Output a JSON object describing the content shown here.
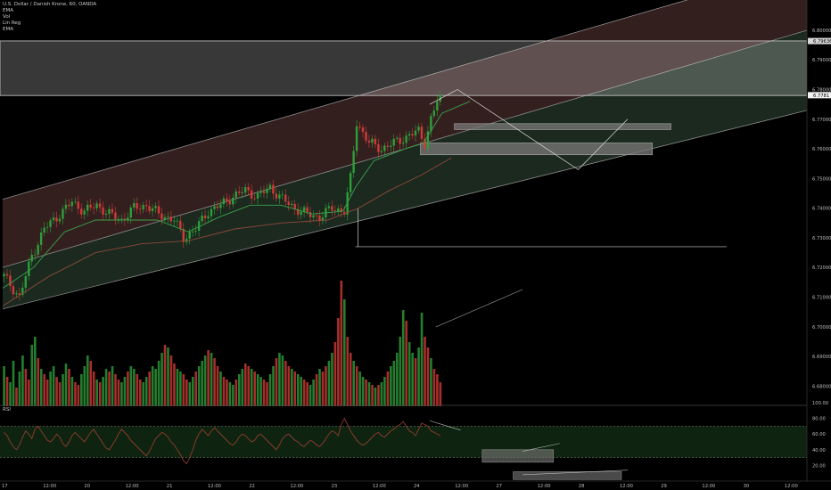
{
  "header": {
    "symbol_line": "U.S. Dollar / Danish Krone, 60, OANDA",
    "indicators": [
      "EMA",
      "Vol",
      "Lin Reg",
      "EMA"
    ]
  },
  "rsi_label": "RSI",
  "colors": {
    "background": "#000000",
    "up": "#2e9e3a",
    "down": "#d03a36",
    "channel_upper": "#3a2222",
    "channel_lower": "#1f2e22",
    "zone": "#7a7a7a",
    "rsi_band": "#0f2410",
    "axis_text": "#bdbdbd"
  },
  "chart_data": [
    {
      "type": "candlestick",
      "title": "",
      "ylim": [
        6.675,
        6.809
      ],
      "y_ticks": [
        "6.80000",
        "6.79000",
        "6.78000",
        "6.77000",
        "6.76000",
        "6.75000",
        "6.74000",
        "6.73000",
        "6.72000",
        "6.71000",
        "6.70000",
        "6.69000",
        "6.68000"
      ],
      "x_ticks": [
        "17",
        "12:00",
        "20",
        "12:00",
        "21",
        "12:00",
        "22",
        "12:00",
        "23",
        "12:00",
        "24",
        "12:00",
        "27",
        "12:00",
        "28",
        "12:00",
        "29",
        "12:00",
        "30",
        "12:00"
      ],
      "price_labels": [
        "6.79636",
        "6.7781"
      ],
      "close_pts": [
        [
          0,
          6.717
        ],
        [
          5,
          6.71
        ],
        [
          9,
          6.724
        ],
        [
          13,
          6.733
        ],
        [
          18,
          6.738
        ],
        [
          22,
          6.742
        ],
        [
          26,
          6.739
        ],
        [
          30,
          6.741
        ],
        [
          34,
          6.738
        ],
        [
          38,
          6.736
        ],
        [
          42,
          6.74
        ],
        [
          46,
          6.741
        ],
        [
          50,
          6.738
        ],
        [
          55,
          6.736
        ],
        [
          58,
          6.73
        ],
        [
          62,
          6.733
        ],
        [
          66,
          6.739
        ],
        [
          70,
          6.741
        ],
        [
          74,
          6.744
        ],
        [
          78,
          6.746
        ],
        [
          82,
          6.744
        ],
        [
          86,
          6.747
        ],
        [
          90,
          6.743
        ],
        [
          94,
          6.74
        ],
        [
          98,
          6.738
        ],
        [
          102,
          6.737
        ],
        [
          106,
          6.74
        ],
        [
          110,
          6.739
        ],
        [
          112,
          6.75
        ],
        [
          114,
          6.769
        ],
        [
          118,
          6.762
        ],
        [
          122,
          6.76
        ],
        [
          126,
          6.762
        ],
        [
          130,
          6.764
        ],
        [
          134,
          6.766
        ],
        [
          136,
          6.762
        ],
        [
          138,
          6.77
        ],
        [
          140,
          6.776
        ],
        [
          143,
          6.779
        ],
        [
          146,
          6.78
        ],
        [
          149,
          6.779
        ],
        [
          151,
          6.778
        ]
      ],
      "ema_fast": [
        [
          0,
          6.713
        ],
        [
          10,
          6.72
        ],
        [
          20,
          6.732
        ],
        [
          30,
          6.736
        ],
        [
          40,
          6.736
        ],
        [
          50,
          6.736
        ],
        [
          60,
          6.732
        ],
        [
          70,
          6.737
        ],
        [
          80,
          6.741
        ],
        [
          90,
          6.741
        ],
        [
          100,
          6.738
        ],
        [
          110,
          6.739
        ],
        [
          114,
          6.747
        ],
        [
          120,
          6.756
        ],
        [
          130,
          6.76
        ],
        [
          136,
          6.762
        ],
        [
          142,
          6.772
        ],
        [
          151,
          6.776
        ]
      ],
      "ema_slow": [
        [
          0,
          6.707
        ],
        [
          15,
          6.717
        ],
        [
          30,
          6.725
        ],
        [
          45,
          6.728
        ],
        [
          60,
          6.729
        ],
        [
          75,
          6.733
        ],
        [
          90,
          6.735
        ],
        [
          105,
          6.736
        ],
        [
          115,
          6.74
        ],
        [
          125,
          6.746
        ],
        [
          135,
          6.751
        ],
        [
          145,
          6.757
        ]
      ],
      "lin_reg_channel": {
        "start_index": 0,
        "end_index": 260,
        "upper": [
          6.743,
          6.822
        ],
        "middle": [
          6.72,
          6.8
        ],
        "lower": [
          6.706,
          6.773
        ]
      },
      "resistance_zone": {
        "upper": 6.7964,
        "lower": 6.778
      },
      "demand_zones": [
        {
          "start_index": 146,
          "end_index": 216,
          "upper": 6.7685,
          "lower": 6.7665
        },
        {
          "start_index": 135,
          "end_index": 210,
          "upper": 6.762,
          "lower": 6.758
        }
      ],
      "support_line": {
        "start_index": 114,
        "end_index": 234,
        "value": 6.727
      },
      "projection_path": [
        [
          138,
          6.775
        ],
        [
          147,
          6.78
        ],
        [
          186,
          6.753
        ],
        [
          202,
          6.77
        ]
      ]
    },
    {
      "type": "bar",
      "title": "",
      "series_name": "",
      "ylim": [
        0,
        100
      ],
      "values": [
        30,
        22,
        18,
        34,
        14,
        26,
        38,
        28,
        20,
        46,
        52,
        36,
        28,
        24,
        20,
        26,
        30,
        22,
        18,
        24,
        32,
        28,
        22,
        18,
        16,
        24,
        30,
        38,
        34,
        26,
        20,
        18,
        22,
        28,
        26,
        30,
        24,
        20,
        18,
        22,
        26,
        30,
        28,
        24,
        20,
        18,
        22,
        26,
        30,
        28,
        34,
        40,
        46,
        44,
        38,
        32,
        28,
        26,
        24,
        20,
        18,
        22,
        26,
        30,
        34,
        38,
        42,
        40,
        36,
        30,
        26,
        22,
        20,
        18,
        16,
        20,
        24,
        28,
        32,
        30,
        28,
        26,
        24,
        22,
        20,
        18,
        24,
        30,
        36,
        40,
        38,
        34,
        30,
        28,
        26,
        24,
        22,
        20,
        18,
        16,
        20,
        24,
        28,
        26,
        30,
        34,
        40,
        48,
        66,
        94,
        80,
        52,
        40,
        34,
        30,
        26,
        22,
        20,
        18,
        16,
        14,
        16,
        18,
        22,
        26,
        30,
        34,
        40,
        52,
        72,
        64,
        48,
        40,
        36,
        44,
        70,
        52,
        44,
        36,
        28,
        24,
        18
      ],
      "up": [
        1,
        0,
        1,
        1,
        0,
        1,
        1,
        0,
        0,
        1,
        1,
        0,
        1,
        0,
        0,
        1,
        1,
        0,
        0,
        1,
        1,
        0,
        1,
        0,
        0,
        1,
        1,
        1,
        0,
        0,
        1,
        0,
        1,
        1,
        0,
        1,
        0,
        0,
        1,
        1,
        0,
        1,
        1,
        0,
        0,
        1,
        1,
        0,
        1,
        1,
        1,
        1,
        0,
        1,
        0,
        0,
        1,
        1,
        0,
        0,
        1,
        1,
        0,
        1,
        1,
        1,
        0,
        1,
        0,
        0,
        1,
        0,
        0,
        1,
        1,
        0,
        1,
        1,
        0,
        0,
        1,
        0,
        1,
        1,
        0,
        0,
        1,
        1,
        0,
        1,
        1,
        0,
        0,
        1,
        0,
        1,
        1,
        0,
        0,
        1,
        1,
        0,
        1,
        0,
        0,
        1,
        1,
        0,
        0,
        0,
        1,
        0,
        0,
        1,
        0,
        1,
        1,
        0,
        1,
        0,
        1,
        0,
        1,
        1,
        0,
        1,
        1,
        1,
        1,
        1,
        0,
        1,
        1,
        0,
        1,
        1,
        0,
        0,
        1,
        0,
        0,
        0
      ],
      "trend_line": [
        [
          140,
          6
        ],
        [
          168,
          34
        ]
      ]
    },
    {
      "type": "line",
      "title": "",
      "series_name": "",
      "ylim": [
        0,
        100
      ],
      "y_ticks": [
        "100.00",
        "80.00",
        "60.00",
        "40.00",
        "20.00"
      ],
      "band": [
        30,
        70
      ],
      "values": [
        62,
        58,
        50,
        44,
        40,
        46,
        56,
        64,
        60,
        54,
        66,
        70,
        64,
        58,
        52,
        50,
        54,
        60,
        56,
        48,
        44,
        50,
        58,
        62,
        58,
        54,
        50,
        56,
        62,
        66,
        60,
        54,
        48,
        42,
        40,
        46,
        52,
        60,
        66,
        62,
        58,
        52,
        48,
        44,
        40,
        36,
        32,
        38,
        46,
        54,
        58,
        62,
        60,
        56,
        50,
        46,
        40,
        34,
        26,
        22,
        30,
        40,
        52,
        60,
        66,
        62,
        58,
        64,
        68,
        64,
        60,
        56,
        52,
        48,
        46,
        50,
        56,
        60,
        58,
        54,
        50,
        52,
        58,
        60,
        56,
        52,
        48,
        44,
        40,
        46,
        54,
        58,
        60,
        56,
        52,
        50,
        46,
        44,
        48,
        52,
        50,
        46,
        44,
        48,
        54,
        60,
        64,
        62,
        58,
        72,
        80,
        72,
        64,
        58,
        52,
        48,
        46,
        48,
        52,
        56,
        60,
        62,
        58,
        56,
        60,
        64,
        66,
        70,
        72,
        76,
        70,
        64,
        62,
        58,
        66,
        74,
        72,
        70,
        64,
        62,
        60,
        58
      ],
      "zones": [
        {
          "start_index": 155,
          "end_index": 178,
          "upper": 40,
          "lower": 24
        },
        {
          "start_index": 165,
          "end_index": 200,
          "upper": 12,
          "lower": 2
        }
      ],
      "trend_lines": [
        [
          [
            138,
            77
          ],
          [
            148,
            65
          ]
        ],
        [
          [
            168,
            38
          ],
          [
            180,
            48
          ]
        ],
        [
          [
            168,
            8
          ],
          [
            202,
            14
          ]
        ]
      ]
    }
  ]
}
